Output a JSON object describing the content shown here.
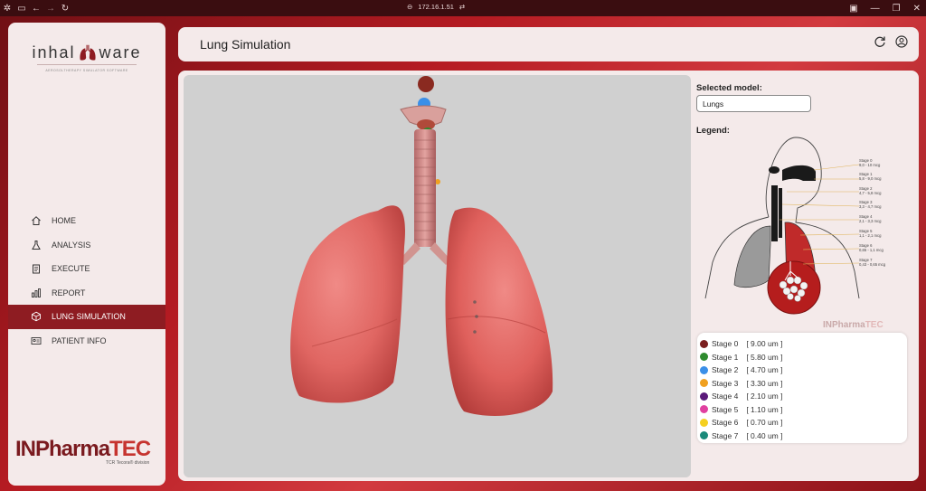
{
  "browser": {
    "url": "172.16.1.51"
  },
  "app": {
    "brand_left": "inhal",
    "brand_right": "ware",
    "tagline": "AEROSOLTHERAPY SIMULATOR SOFTWARE",
    "vendor_left": "INPharma",
    "vendor_right": "TEC",
    "vendor_sub": "TCR Tecora® division"
  },
  "sidebar": {
    "items": [
      {
        "label": "HOME",
        "icon": "home-icon"
      },
      {
        "label": "ANALYSIS",
        "icon": "flask-icon"
      },
      {
        "label": "EXECUTE",
        "icon": "clipboard-icon"
      },
      {
        "label": "REPORT",
        "icon": "bar-chart-icon"
      },
      {
        "label": "LUNG SIMULATION",
        "icon": "cube-icon",
        "active": true
      },
      {
        "label": "PATIENT INFO",
        "icon": "id-card-icon"
      }
    ]
  },
  "header": {
    "title": "Lung Simulation"
  },
  "panel": {
    "selected_model_label": "Selected model:",
    "selected_model_value": "Lungs",
    "legend_label": "Legend:",
    "diagram_watermark_left": "INPharma",
    "diagram_watermark_right": "TEC"
  },
  "diagram_stages": [
    {
      "name": "Stage 0",
      "range": "9,0 - 10 mcg"
    },
    {
      "name": "Stage 1",
      "range": "5,8 - 9,0 mcg"
    },
    {
      "name": "Stage 2",
      "range": "4,7 - 5,8 mcg"
    },
    {
      "name": "Stage 3",
      "range": "3,3 - 4,7 mcg"
    },
    {
      "name": "Stage 4",
      "range": "2,1 - 3,3 mcg"
    },
    {
      "name": "Stage 5",
      "range": "1,1 - 2,1 mcg"
    },
    {
      "name": "Stage 6",
      "range": "0,65 - 1,1 mcg"
    },
    {
      "name": "Stage 7",
      "range": "0,43 - 0,65 mcg"
    }
  ],
  "legend": [
    {
      "stage": "Stage 0",
      "size": "[ 9.00 um ]",
      "color": "#7a1f1f"
    },
    {
      "stage": "Stage 1",
      "size": "[ 5.80 um ]",
      "color": "#2e8b2e"
    },
    {
      "stage": "Stage 2",
      "size": "[ 4.70 um ]",
      "color": "#3b8fe8"
    },
    {
      "stage": "Stage 3",
      "size": "[ 3.30 um ]",
      "color": "#f0a020"
    },
    {
      "stage": "Stage 4",
      "size": "[ 2.10 um ]",
      "color": "#5a1a7a"
    },
    {
      "stage": "Stage 5",
      "size": "[ 1.10 um ]",
      "color": "#e040a0"
    },
    {
      "stage": "Stage 6",
      "size": "[ 0.70 um ]",
      "color": "#f5d020"
    },
    {
      "stage": "Stage 7",
      "size": "[ 0.40 um ]",
      "color": "#1a8a7a"
    }
  ]
}
